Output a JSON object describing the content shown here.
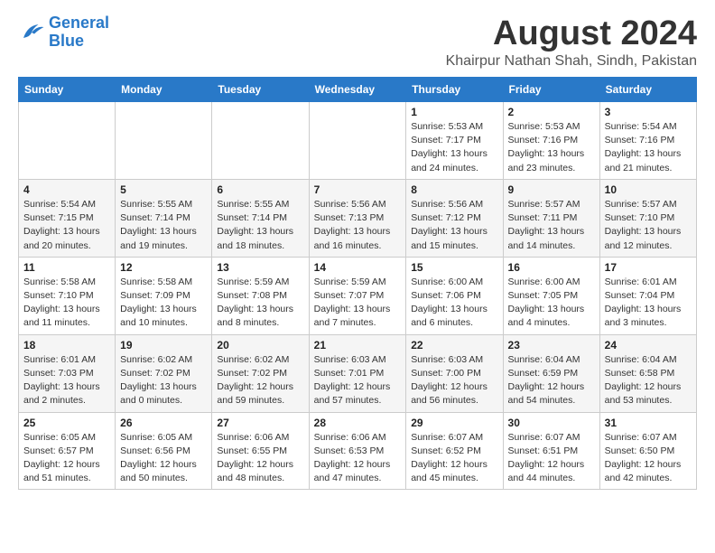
{
  "logo": {
    "line1": "General",
    "line2": "Blue"
  },
  "title": "August 2024",
  "location": "Khairpur Nathan Shah, Sindh, Pakistan",
  "weekdays": [
    "Sunday",
    "Monday",
    "Tuesday",
    "Wednesday",
    "Thursday",
    "Friday",
    "Saturday"
  ],
  "weeks": [
    [
      {
        "day": "",
        "info": ""
      },
      {
        "day": "",
        "info": ""
      },
      {
        "day": "",
        "info": ""
      },
      {
        "day": "",
        "info": ""
      },
      {
        "day": "1",
        "info": "Sunrise: 5:53 AM\nSunset: 7:17 PM\nDaylight: 13 hours\nand 24 minutes."
      },
      {
        "day": "2",
        "info": "Sunrise: 5:53 AM\nSunset: 7:16 PM\nDaylight: 13 hours\nand 23 minutes."
      },
      {
        "day": "3",
        "info": "Sunrise: 5:54 AM\nSunset: 7:16 PM\nDaylight: 13 hours\nand 21 minutes."
      }
    ],
    [
      {
        "day": "4",
        "info": "Sunrise: 5:54 AM\nSunset: 7:15 PM\nDaylight: 13 hours\nand 20 minutes."
      },
      {
        "day": "5",
        "info": "Sunrise: 5:55 AM\nSunset: 7:14 PM\nDaylight: 13 hours\nand 19 minutes."
      },
      {
        "day": "6",
        "info": "Sunrise: 5:55 AM\nSunset: 7:14 PM\nDaylight: 13 hours\nand 18 minutes."
      },
      {
        "day": "7",
        "info": "Sunrise: 5:56 AM\nSunset: 7:13 PM\nDaylight: 13 hours\nand 16 minutes."
      },
      {
        "day": "8",
        "info": "Sunrise: 5:56 AM\nSunset: 7:12 PM\nDaylight: 13 hours\nand 15 minutes."
      },
      {
        "day": "9",
        "info": "Sunrise: 5:57 AM\nSunset: 7:11 PM\nDaylight: 13 hours\nand 14 minutes."
      },
      {
        "day": "10",
        "info": "Sunrise: 5:57 AM\nSunset: 7:10 PM\nDaylight: 13 hours\nand 12 minutes."
      }
    ],
    [
      {
        "day": "11",
        "info": "Sunrise: 5:58 AM\nSunset: 7:10 PM\nDaylight: 13 hours\nand 11 minutes."
      },
      {
        "day": "12",
        "info": "Sunrise: 5:58 AM\nSunset: 7:09 PM\nDaylight: 13 hours\nand 10 minutes."
      },
      {
        "day": "13",
        "info": "Sunrise: 5:59 AM\nSunset: 7:08 PM\nDaylight: 13 hours\nand 8 minutes."
      },
      {
        "day": "14",
        "info": "Sunrise: 5:59 AM\nSunset: 7:07 PM\nDaylight: 13 hours\nand 7 minutes."
      },
      {
        "day": "15",
        "info": "Sunrise: 6:00 AM\nSunset: 7:06 PM\nDaylight: 13 hours\nand 6 minutes."
      },
      {
        "day": "16",
        "info": "Sunrise: 6:00 AM\nSunset: 7:05 PM\nDaylight: 13 hours\nand 4 minutes."
      },
      {
        "day": "17",
        "info": "Sunrise: 6:01 AM\nSunset: 7:04 PM\nDaylight: 13 hours\nand 3 minutes."
      }
    ],
    [
      {
        "day": "18",
        "info": "Sunrise: 6:01 AM\nSunset: 7:03 PM\nDaylight: 13 hours\nand 2 minutes."
      },
      {
        "day": "19",
        "info": "Sunrise: 6:02 AM\nSunset: 7:02 PM\nDaylight: 13 hours\nand 0 minutes."
      },
      {
        "day": "20",
        "info": "Sunrise: 6:02 AM\nSunset: 7:02 PM\nDaylight: 12 hours\nand 59 minutes."
      },
      {
        "day": "21",
        "info": "Sunrise: 6:03 AM\nSunset: 7:01 PM\nDaylight: 12 hours\nand 57 minutes."
      },
      {
        "day": "22",
        "info": "Sunrise: 6:03 AM\nSunset: 7:00 PM\nDaylight: 12 hours\nand 56 minutes."
      },
      {
        "day": "23",
        "info": "Sunrise: 6:04 AM\nSunset: 6:59 PM\nDaylight: 12 hours\nand 54 minutes."
      },
      {
        "day": "24",
        "info": "Sunrise: 6:04 AM\nSunset: 6:58 PM\nDaylight: 12 hours\nand 53 minutes."
      }
    ],
    [
      {
        "day": "25",
        "info": "Sunrise: 6:05 AM\nSunset: 6:57 PM\nDaylight: 12 hours\nand 51 minutes."
      },
      {
        "day": "26",
        "info": "Sunrise: 6:05 AM\nSunset: 6:56 PM\nDaylight: 12 hours\nand 50 minutes."
      },
      {
        "day": "27",
        "info": "Sunrise: 6:06 AM\nSunset: 6:55 PM\nDaylight: 12 hours\nand 48 minutes."
      },
      {
        "day": "28",
        "info": "Sunrise: 6:06 AM\nSunset: 6:53 PM\nDaylight: 12 hours\nand 47 minutes."
      },
      {
        "day": "29",
        "info": "Sunrise: 6:07 AM\nSunset: 6:52 PM\nDaylight: 12 hours\nand 45 minutes."
      },
      {
        "day": "30",
        "info": "Sunrise: 6:07 AM\nSunset: 6:51 PM\nDaylight: 12 hours\nand 44 minutes."
      },
      {
        "day": "31",
        "info": "Sunrise: 6:07 AM\nSunset: 6:50 PM\nDaylight: 12 hours\nand 42 minutes."
      }
    ]
  ]
}
